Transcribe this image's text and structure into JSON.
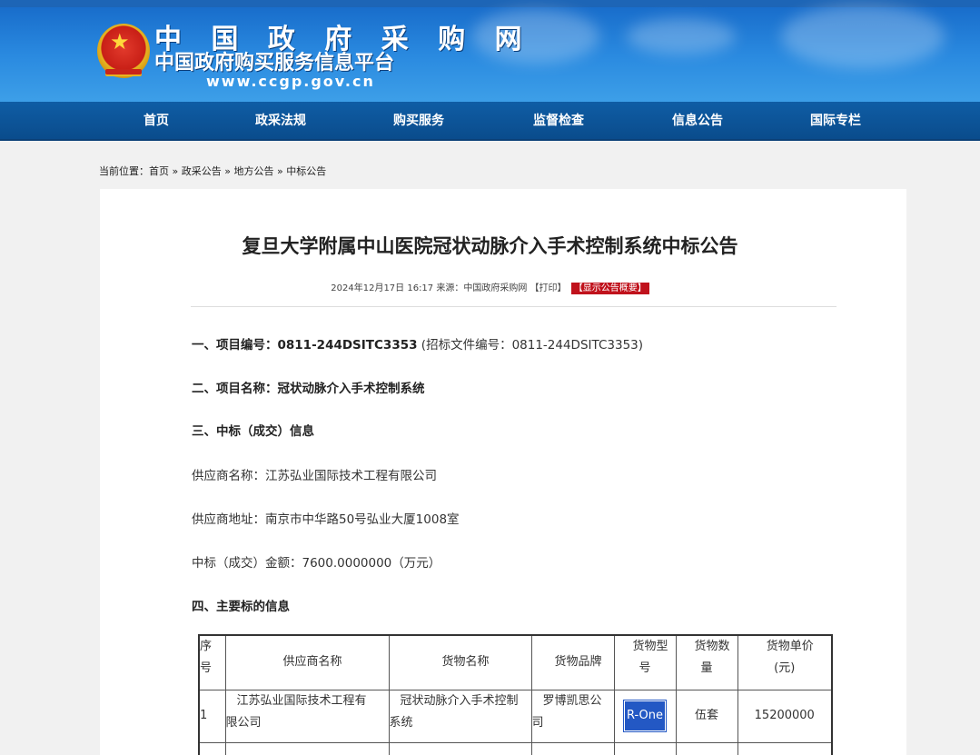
{
  "site": {
    "logo_name": "中国政府采购网",
    "logo_name_display": "中 国 政 府 采 购 网",
    "logo_sub": "中国政府购买服务信息平台",
    "logo_url": "www.ccgp.gov.cn",
    "emblem_icon": "national-emblem-icon"
  },
  "nav": [
    {
      "label": "首页"
    },
    {
      "label": "政采法规"
    },
    {
      "label": "购买服务"
    },
    {
      "label": "监督检查"
    },
    {
      "label": "信息公告"
    },
    {
      "label": "国际专栏"
    }
  ],
  "breadcrumb": {
    "prefix": "当前位置：",
    "items": [
      "首页",
      "政采公告",
      "地方公告",
      "中标公告"
    ],
    "separator": "»"
  },
  "article": {
    "title": "复旦大学附属中山医院冠状动脉介入手术控制系统中标公告",
    "date": "2024年12月17日 16:17",
    "source_label": "来源：",
    "source": "中国政府采购网",
    "print_label": "【打印】",
    "summary_label": "【显示公告概要】",
    "project_no_label": "一、项目编号：",
    "project_no": "0811-244DSITC3353",
    "project_doc_no": "(招标文件编号：0811-244DSITC3353)",
    "project_name_label": "二、项目名称：",
    "project_name": "冠状动脉介入手术控制系统",
    "section3_title": "三、中标（成交）信息",
    "supplier_name_label": "供应商名称：",
    "supplier_name": "江苏弘业国际技术工程有限公司",
    "supplier_addr_label": "供应商地址：",
    "supplier_addr": "南京市中华路50号弘业大厦1008室",
    "amount_label": "中标（成交）金额：",
    "amount": "7600.0000000（万元）",
    "section4_title": "四、主要标的信息"
  },
  "table": {
    "headers": {
      "no_a": "序",
      "no_b": "号",
      "supplier": "供应商名称",
      "goods": "货物名称",
      "brand": "货物品牌",
      "model_a": "货物型",
      "model_b": "号",
      "qty_a": "货物数",
      "qty_b": "量",
      "price_a": "货物单价",
      "price_b": "(元)"
    },
    "rows": [
      {
        "no": "1",
        "supplier_a": "江苏弘业国际技术工程有",
        "supplier_b": "限公司",
        "goods_a": "冠状动脉介入手术控制",
        "goods_b": "系统",
        "brand_a": "罗博凯思公",
        "brand_b": "司",
        "model": "R-One",
        "qty": "伍套",
        "price": "15200000"
      }
    ]
  },
  "colors": {
    "header_blue": "#2a8ae0",
    "nav_blue": "#0a4c8c",
    "summary_red": "#c0121c",
    "highlight_blue": "#2358c4"
  }
}
